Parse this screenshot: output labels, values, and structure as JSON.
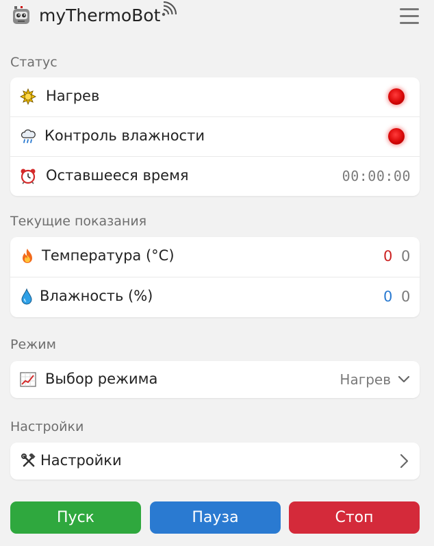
{
  "header": {
    "app_title": "myThermoBot"
  },
  "status": {
    "section_title": "Статус",
    "heating_label": "Нагрев",
    "humidity_control_label": "Контроль влажности",
    "remaining_time_label": "Оставшееся время",
    "remaining_time_value": "00:00:00"
  },
  "readings": {
    "section_title": "Текущие показания",
    "temperature_label": "Температура (°C)",
    "temperature_current": "0",
    "temperature_target": "0",
    "humidity_label": "Влажность (%)",
    "humidity_current": "0",
    "humidity_target": "0"
  },
  "mode": {
    "section_title": "Режим",
    "select_label": "Выбор режима",
    "selected_value": "Нагрев"
  },
  "settings": {
    "section_title": "Настройки",
    "row_label": "Настройки"
  },
  "buttons": {
    "start": "Пуск",
    "pause": "Пауза",
    "stop": "Стоп"
  },
  "colors": {
    "start": "#2fa83e",
    "pause": "#2a7ad1",
    "stop": "#d42a3a",
    "led_off": "#e01010",
    "temperature_value": "#cc2222",
    "humidity_value": "#2a7ad1",
    "background": "#f2f2f2"
  },
  "icons": {
    "logo": "robot-icon",
    "wifi": "wifi-icon",
    "menu": "hamburger-menu-icon",
    "heating": "sun-icon",
    "humidity_control": "cloud-rain-icon",
    "remaining_time": "alarm-clock-icon",
    "temperature": "fire-icon",
    "humidity": "droplet-icon",
    "mode": "chart-increasing-icon",
    "settings": "hammer-wrench-icon",
    "mode_dropdown": "chevron-down-icon",
    "settings_open": "chevron-right-icon"
  }
}
